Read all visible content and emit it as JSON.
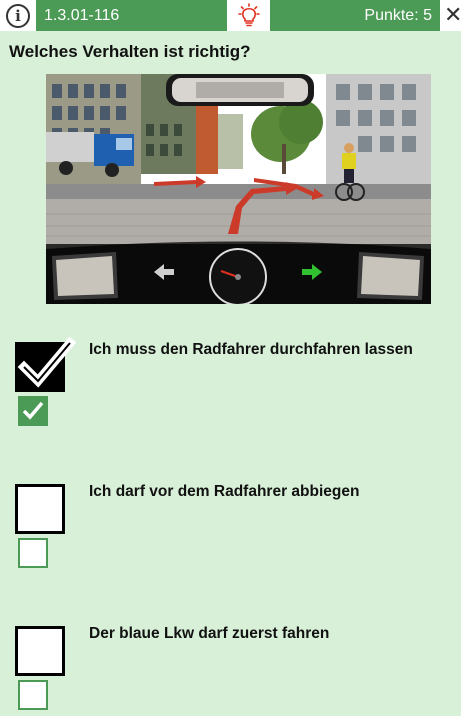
{
  "header": {
    "info_icon": "info-icon",
    "question_id": "1.3.01-116",
    "hint_icon": "lightbulb-icon",
    "points_label": "Punkte: 5",
    "close_icon": "close-icon"
  },
  "question": {
    "text": "Welches Verhalten ist richtig?"
  },
  "answers": [
    {
      "text": "Ich muss den Radfahrer durchfahren lassen",
      "user_checked": true,
      "correct": true
    },
    {
      "text": "Ich darf vor dem Radfahrer abbiegen",
      "user_checked": false,
      "correct": false
    },
    {
      "text": "Der blaue Lkw darf zuerst fahren",
      "user_checked": false,
      "correct": false
    }
  ],
  "colors": {
    "accent_green": "#4b9a55",
    "background": "#d8f0d8",
    "hint_red": "#e03020"
  }
}
